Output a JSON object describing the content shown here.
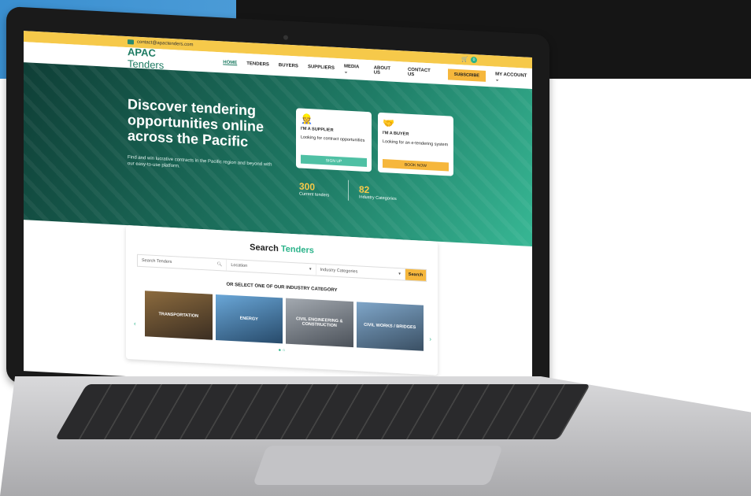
{
  "topbar": {
    "email": "contact@apactenders.com",
    "cart_count": "0"
  },
  "nav": {
    "logo_bold": "APAC",
    "logo_rest": " Tenders",
    "items": [
      "HOME",
      "TENDERS",
      "BUYERS",
      "SUPPLIERS",
      "MEDIA ⌄",
      "ABOUT US",
      "CONTACT US"
    ],
    "subscribe": "SUBSCRIBE",
    "account": "MY ACCOUNT ⌄"
  },
  "hero": {
    "title": "Discover tendering opportunities online across the Pacific",
    "subtitle": "Find and win lucrative contracts in the Pacific region and beyond with our easy-to-use platform.",
    "supplier": {
      "title": "I'M A SUPPLIER",
      "desc": "Looking for contract opportunities",
      "button": "SIGN UP"
    },
    "buyer": {
      "title": "I'M A BUYER",
      "desc": "Looking for an e-tendering system",
      "button": "BOOK NOW"
    },
    "stats": [
      {
        "value": "300",
        "label": "Current tenders"
      },
      {
        "value": "82",
        "label": "Industry Categories"
      }
    ]
  },
  "search": {
    "title_a": "Search ",
    "title_b": "Tenders",
    "placeholder": "Search Tenders",
    "location": "Location",
    "category": "Industry Categories",
    "button": "Search",
    "select_title": "OR SELECT ONE OF OUR INDUSTRY CATEGORY",
    "categories": [
      "TRANSPORTATION",
      "ENERGY",
      "CIVIL ENGINEERING & CONSTRUCTION",
      "CIVIL WORKS / BRIDGES"
    ]
  },
  "colors": {
    "brand_green": "#1d7b62",
    "accent_yellow": "#f6b73c",
    "teal": "#2bb38a"
  }
}
